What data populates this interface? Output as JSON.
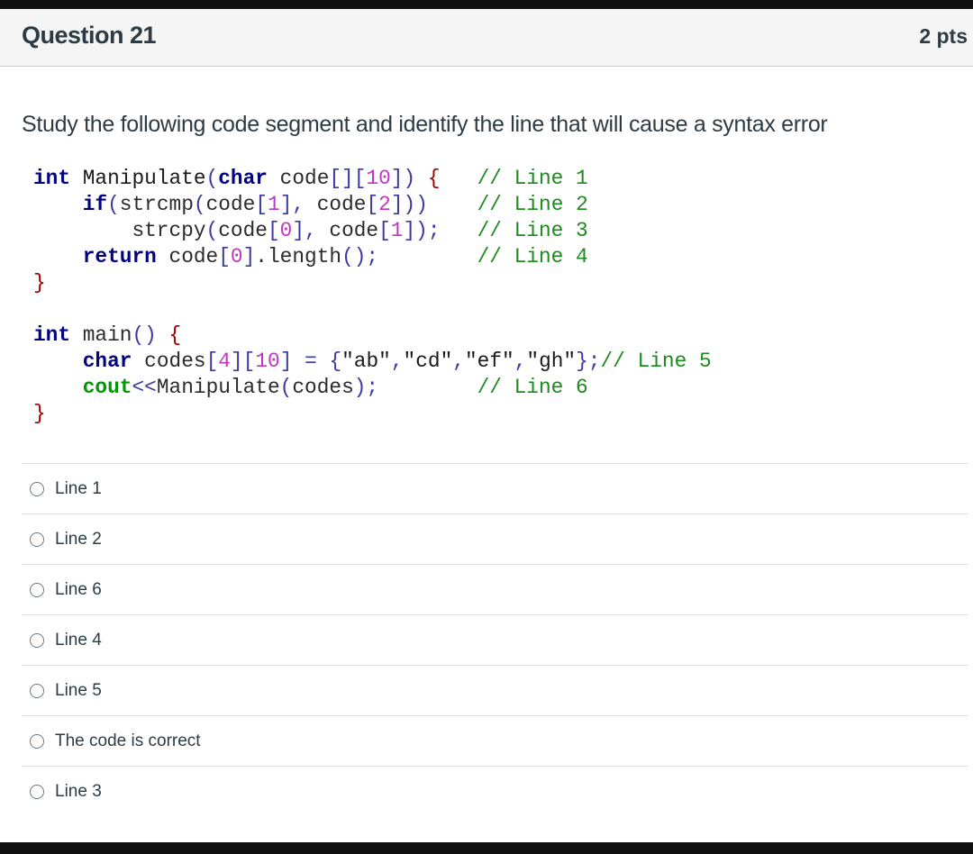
{
  "question": {
    "title": "Question 21",
    "points": "2 pts",
    "prompt": "Study the following code segment and identify the line that will cause a syntax error"
  },
  "code_lines": [
    "int Manipulate(char code[][10]) {   // Line 1",
    "    if(strcmp(code[1], code[2]))    // Line 2",
    "        strcpy(code[0], code[1]);   // Line 3",
    "    return code[0].length();        // Line 4",
    "}",
    "",
    "int main() {",
    "    char codes[4][10] = {\"ab\",\"cd\",\"ef\",\"gh\"};// Line 5",
    "    cout<<Manipulate(codes);        // Line 6",
    "}"
  ],
  "options": [
    {
      "label": "Line 1"
    },
    {
      "label": "Line 2"
    },
    {
      "label": "Line 6"
    },
    {
      "label": "Line 4"
    },
    {
      "label": "Line 5"
    },
    {
      "label": "The code is correct"
    },
    {
      "label": "Line 3"
    }
  ]
}
